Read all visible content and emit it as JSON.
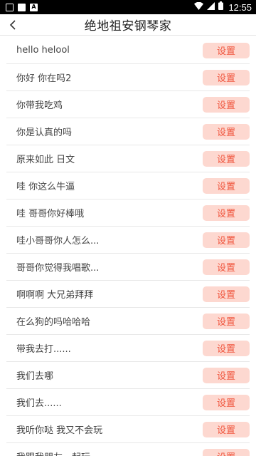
{
  "status_bar": {
    "time": "12:55",
    "notification_icons": [
      "notification-box-icon",
      "notification-filled-icon",
      "notification-a-icon"
    ],
    "notif_letter": "A"
  },
  "header": {
    "title": "绝地祖安钢琴家"
  },
  "colors": {
    "button_bg": "#fdd8d0",
    "button_text": "#f0553d"
  },
  "list": {
    "items": [
      {
        "label": "hello helool",
        "button": "设置"
      },
      {
        "label": "你好 你在吗2",
        "button": "设置"
      },
      {
        "label": "你带我吃鸡",
        "button": "设置"
      },
      {
        "label": "你是认真的吗",
        "button": "设置"
      },
      {
        "label": "原来如此 日文",
        "button": "设置"
      },
      {
        "label": "哇 你这么牛逼",
        "button": "设置"
      },
      {
        "label": "哇 哥哥你好棒哦",
        "button": "设置"
      },
      {
        "label": " 哇小哥哥你人怎么...",
        "button": "设置"
      },
      {
        "label": " 哥哥你觉得我唱歌...",
        "button": "设置"
      },
      {
        "label": "啊啊啊 大兄弟拜拜",
        "button": "设置"
      },
      {
        "label": "在么狗的吗哈哈哈",
        "button": "设置"
      },
      {
        "label": "带我去打......",
        "button": "设置"
      },
      {
        "label": "我们去哪",
        "button": "设置"
      },
      {
        "label": "我们去......",
        "button": "设置"
      },
      {
        "label": "我听你哒 我又不会玩",
        "button": "设置"
      },
      {
        "label": "我跟我朋友一起玩",
        "button": "设置"
      }
    ]
  }
}
